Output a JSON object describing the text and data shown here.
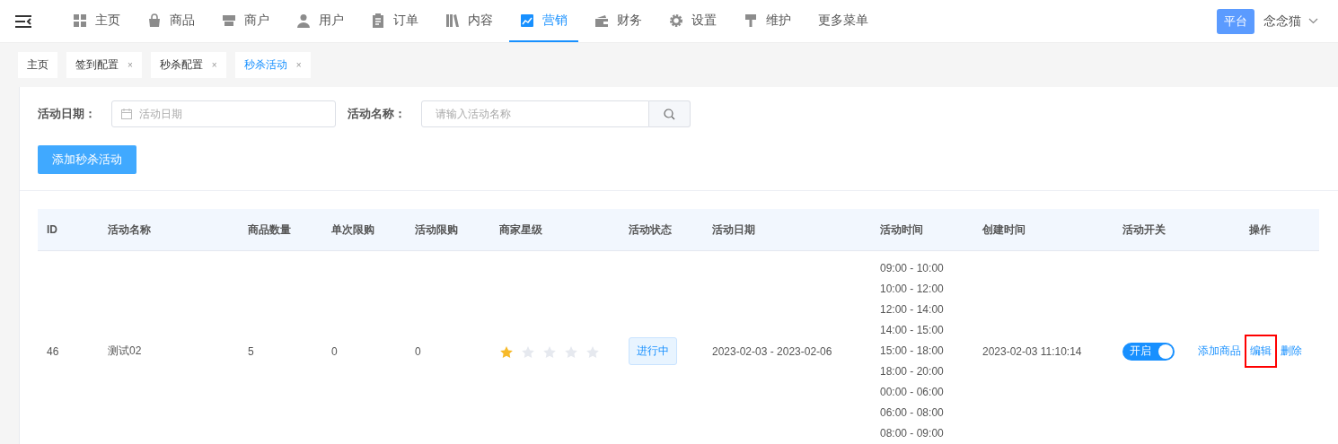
{
  "nav": {
    "items": [
      {
        "label": "主页",
        "selected": false
      },
      {
        "label": "商品",
        "selected": false
      },
      {
        "label": "商户",
        "selected": false
      },
      {
        "label": "用户",
        "selected": false
      },
      {
        "label": "订单",
        "selected": false
      },
      {
        "label": "内容",
        "selected": false
      },
      {
        "label": "营销",
        "selected": true
      },
      {
        "label": "财务",
        "selected": false
      },
      {
        "label": "设置",
        "selected": false
      },
      {
        "label": "维护",
        "selected": false
      },
      {
        "label": "更多菜单",
        "selected": false
      }
    ],
    "platform_badge": "平台",
    "user_name": "念念猫"
  },
  "tabs": [
    {
      "label": "主页",
      "closable": false,
      "selected": false
    },
    {
      "label": "签到配置",
      "closable": true,
      "selected": false
    },
    {
      "label": "秒杀配置",
      "closable": true,
      "selected": false
    },
    {
      "label": "秒杀活动",
      "closable": true,
      "selected": true
    }
  ],
  "close_mark": "×",
  "filters": {
    "date_label": "活动日期：",
    "date_placeholder": "活动日期",
    "name_label": "活动名称：",
    "name_placeholder": "请输入活动名称"
  },
  "add_button": "添加秒杀活动",
  "table": {
    "columns": [
      "ID",
      "活动名称",
      "商品数量",
      "单次限购",
      "活动限购",
      "商家星级",
      "活动状态",
      "活动日期",
      "活动时间",
      "创建时间",
      "活动开关",
      "操作"
    ],
    "rows": [
      {
        "id": "46",
        "name": "测试02",
        "goods_count": "5",
        "single_limit": "0",
        "activity_limit": "0",
        "stars": 1,
        "status": "进行中",
        "date": "2023-02-03 - 2023-02-06",
        "times": [
          "09:00 - 10:00",
          "10:00 - 12:00",
          "12:00 - 14:00",
          "14:00 - 15:00",
          "15:00 - 18:00",
          "18:00 - 20:00",
          "00:00 - 06:00",
          "06:00 - 08:00",
          "08:00 - 09:00"
        ],
        "created": "2023-02-03 11:10:14",
        "switch": {
          "label": "开启",
          "on": true
        },
        "actions": [
          {
            "label": "添加商品",
            "highlighted": false
          },
          {
            "label": "编辑",
            "highlighted": true
          },
          {
            "label": "删除",
            "highlighted": false
          }
        ]
      }
    ]
  }
}
